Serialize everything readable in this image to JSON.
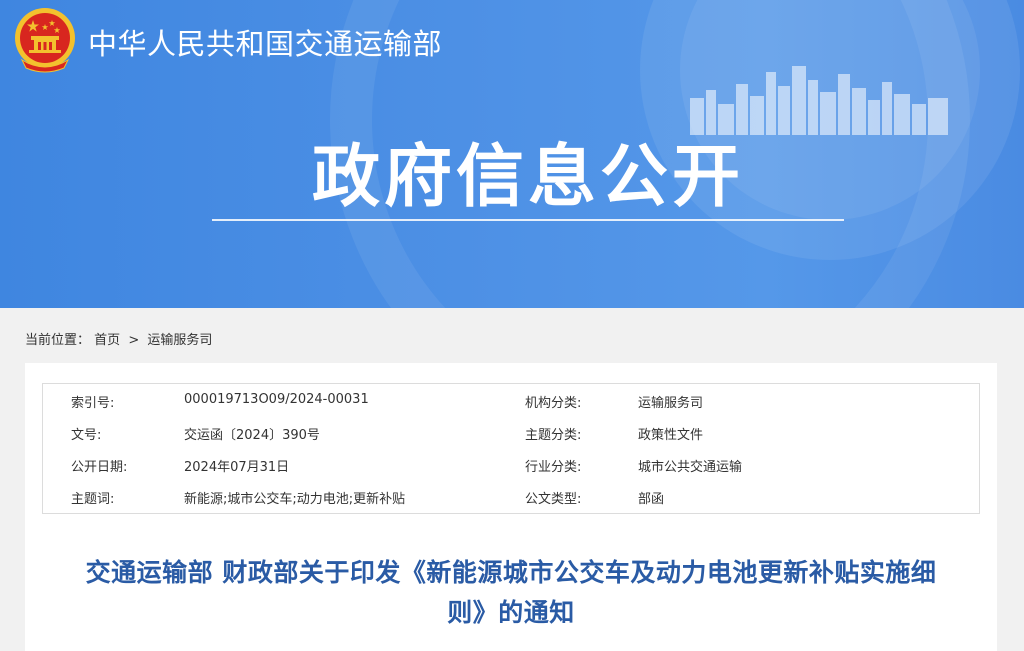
{
  "header": {
    "site_title": "中华人民共和国交通运输部",
    "section_title": "政府信息公开"
  },
  "breadcrumb": {
    "prefix": "当前位置：",
    "items": [
      "首页",
      "运输服务司"
    ],
    "separator": ">"
  },
  "metadata": {
    "rows": [
      {
        "label1": "索引号:",
        "value1": "000019713O09/2024-00031",
        "label2": "机构分类:",
        "value2": "运输服务司"
      },
      {
        "label1": "文号:",
        "value1": "交运函〔2024〕390号",
        "label2": "主题分类:",
        "value2": "政策性文件"
      },
      {
        "label1": "公开日期:",
        "value1": "2024年07月31日",
        "label2": "行业分类:",
        "value2": "城市公共交通运输"
      },
      {
        "label1": "主题词:",
        "value1": "新能源;城市公交车;动力电池;更新补贴",
        "label2": "公文类型:",
        "value2": "部函"
      }
    ]
  },
  "document": {
    "title_line1": "交通运输部 财政部关于印发《新能源城市公交车及动力电池更新补贴实施细",
    "title_line2": "则》的通知"
  },
  "colors": {
    "banner_blue": "#4a8be2",
    "title_blue": "#2a5ba5",
    "emblem_red": "#d8261f",
    "emblem_gold": "#f3c12e"
  },
  "icons": {
    "emblem": "national-emblem-icon",
    "skyline": "city-skyline-decoration"
  }
}
